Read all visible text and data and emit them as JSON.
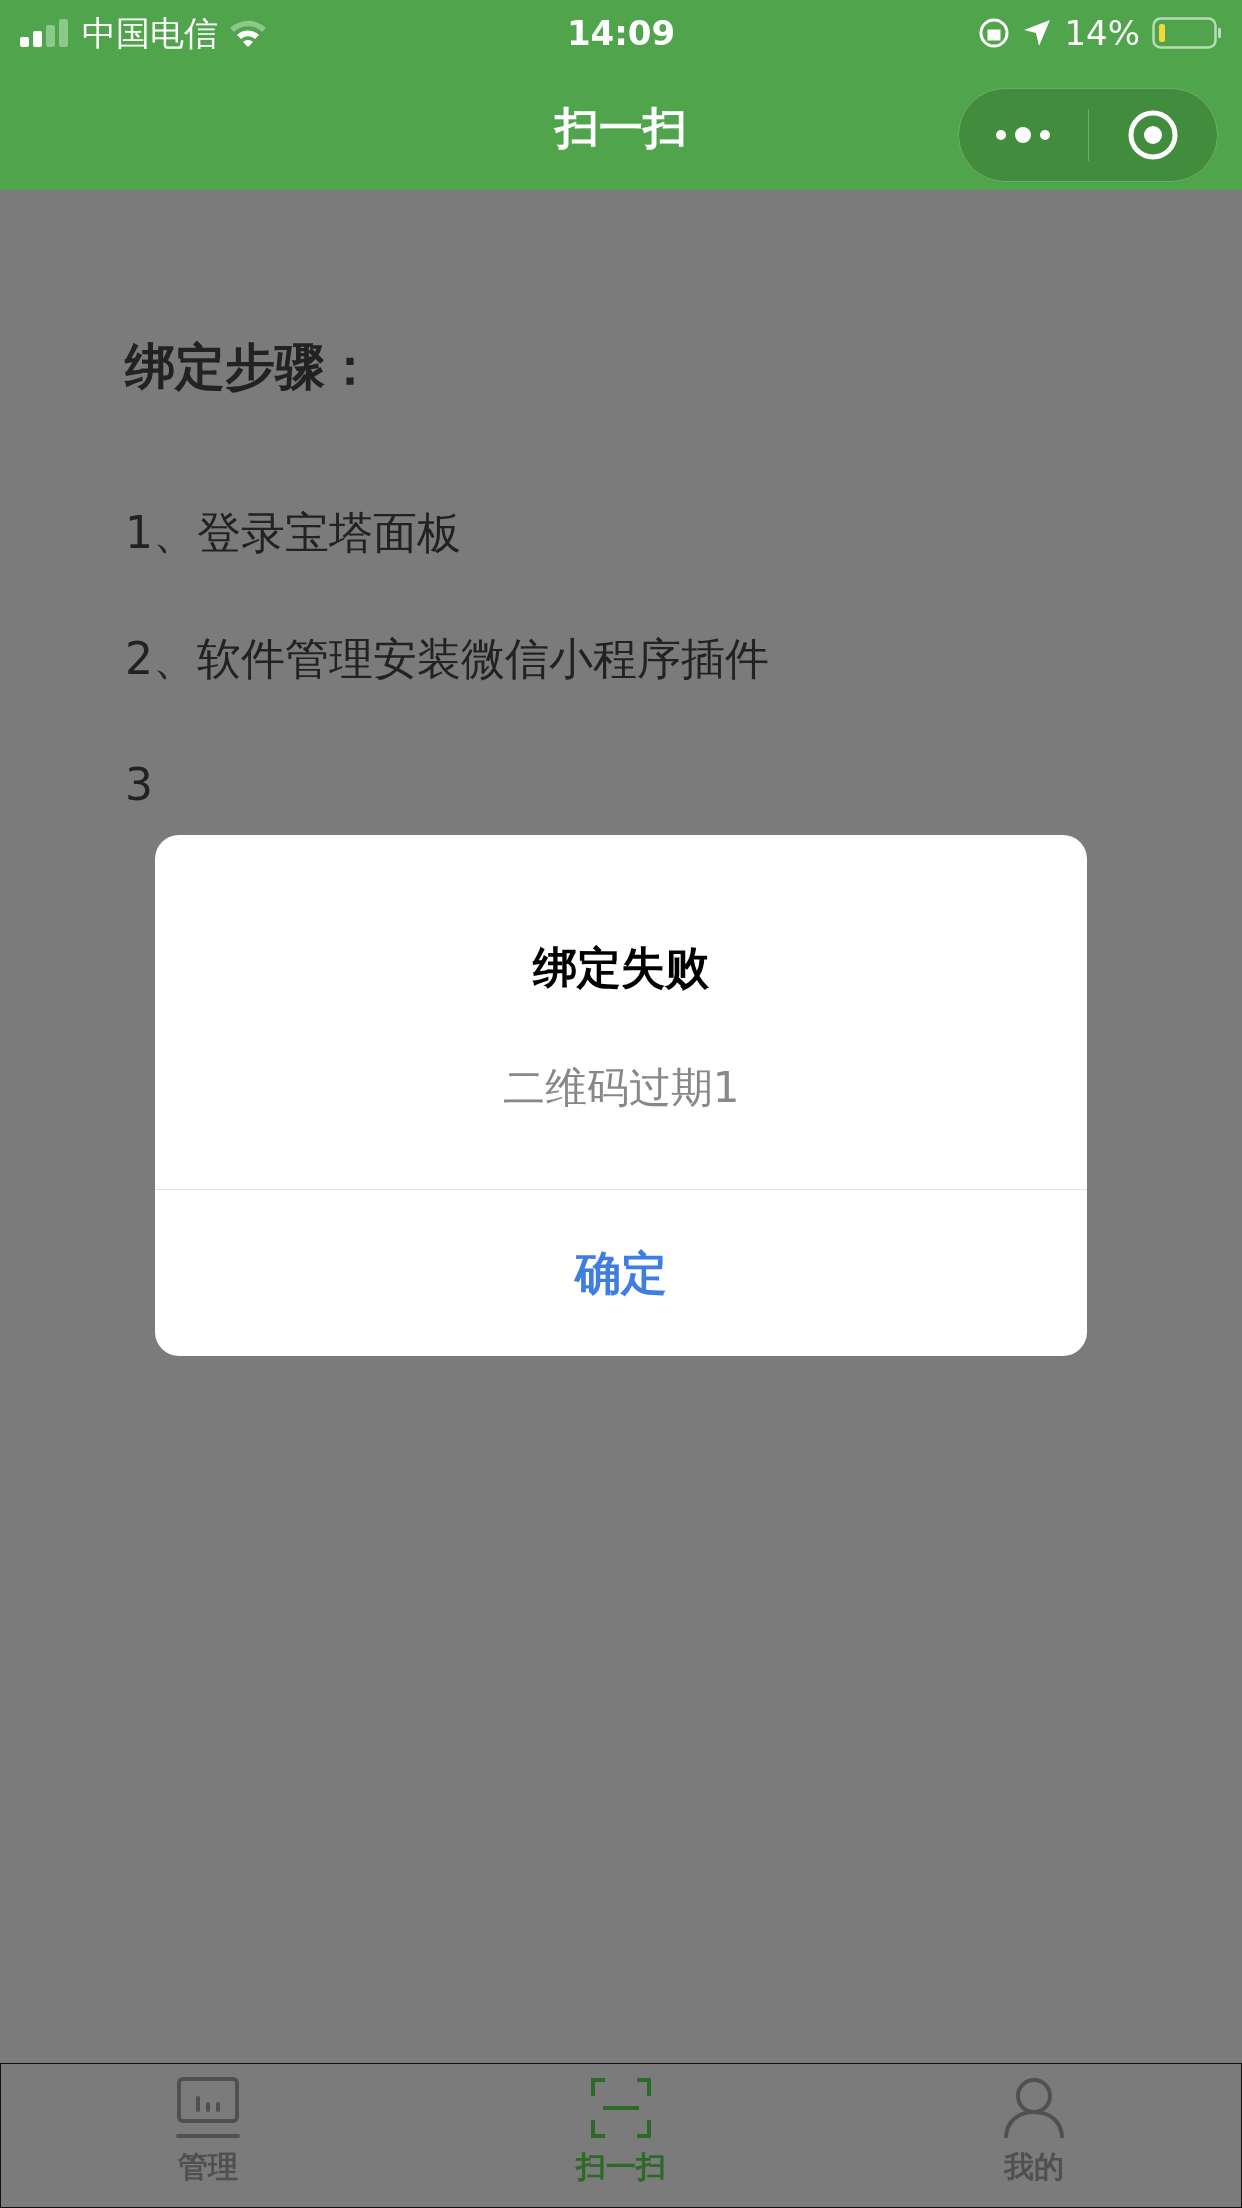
{
  "status_bar": {
    "carrier": "中国电信",
    "time": "14:09",
    "battery": "14%"
  },
  "nav": {
    "title": "扫一扫"
  },
  "heading": "绑定步骤：",
  "steps": [
    "1、登录宝塔面板",
    "2、软件管理安装微信小程序插件",
    "3"
  ],
  "dialog": {
    "title": "绑定失败",
    "message": "二维码过期1",
    "button": "确定"
  },
  "tab_bar": [
    {
      "label": "管理",
      "kind": "panel",
      "selected": false
    },
    {
      "label": "扫一扫",
      "kind": "scan",
      "selected": true
    },
    {
      "label": "我的",
      "kind": "person",
      "selected": false
    }
  ]
}
